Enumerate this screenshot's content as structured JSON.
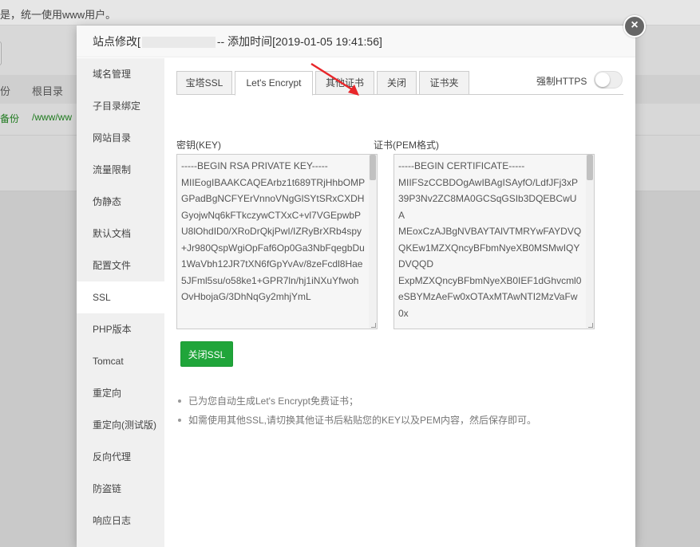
{
  "background": {
    "notice_text": "是，统一使用www用户。",
    "table_headers": [
      "份",
      "根目录"
    ],
    "row": {
      "backup": "备份",
      "path": "/www/ww"
    }
  },
  "modal": {
    "title_prefix": "站点修改[",
    "title_suffix": "-- 添加时间[2019-01-05 19:41:56]",
    "close_icon": "×"
  },
  "sidebar": {
    "items": [
      {
        "label": "域名管理"
      },
      {
        "label": "子目录绑定"
      },
      {
        "label": "网站目录"
      },
      {
        "label": "流量限制"
      },
      {
        "label": "伪静态"
      },
      {
        "label": "默认文档"
      },
      {
        "label": "配置文件"
      },
      {
        "label": "SSL"
      },
      {
        "label": "PHP版本"
      },
      {
        "label": "Tomcat"
      },
      {
        "label": "重定向"
      },
      {
        "label": "重定向(测试版)"
      },
      {
        "label": "反向代理"
      },
      {
        "label": "防盗链"
      },
      {
        "label": "响应日志"
      }
    ],
    "active": "SSL"
  },
  "tabs": [
    {
      "label": "宝塔SSL"
    },
    {
      "label": "Let's Encrypt"
    },
    {
      "label": "其他证书"
    },
    {
      "label": "关闭"
    },
    {
      "label": "证书夹"
    }
  ],
  "active_tab": "Let's Encrypt",
  "https_toggle": {
    "label": "强制HTTPS",
    "on": false
  },
  "key_field": {
    "label": "密钥(KEY)",
    "value": "-----BEGIN RSA PRIVATE KEY-----\nMIIEogIBAAKCAQEArbz1t689TRjHhbOMPGPadBgNCFYErVnnoVNgGlSYtSRxCXDH\nGyojwNq6kFTkczywCTXxC+vl7VGEpwbPU8lOhdID0/XRoDrQkjPwI/IZRyBrXRb4spy+Jr980QspWgiOpFaf6Op0Ga3NbFqegbDu1WaVbh12JR7tXN6fGpYvAv/8zeFcdl8Hae5JFml5su/o58ke1+GPR7ln/hj1iNXuYfwohOvHbojaG/3DhNqGy2mhjYmL"
  },
  "cert_field": {
    "label": "证书(PEM格式)",
    "value": "-----BEGIN CERTIFICATE-----\nMIIFSzCCBDOgAwIBAgISAyfO/LdfJFj3xP39P3Nv2ZC8MA0GCSqGSIb3DQEBCwUA\nMEoxCzAJBgNVBAYTAlVTMRYwFAYDVQQKEw1MZXQncyBFbmNyeXB0MSMwIQYDVQQD\nExpMZXQncyBFbmNyeXB0IEF1dGhvcml0eSBYMzAeFw0xOTAxMTAwNTI2MzVaFw0x"
  },
  "close_ssl_button": "关闭SSL",
  "tips": [
    "已为您自动生成Let's Encrypt免费证书；",
    "如需使用其他SSL,请切换其他证书后粘贴您的KEY以及PEM内容，然后保存即可。"
  ],
  "accent_colors": {
    "green": "#20a53a",
    "arrow_red": "#e8262a"
  }
}
